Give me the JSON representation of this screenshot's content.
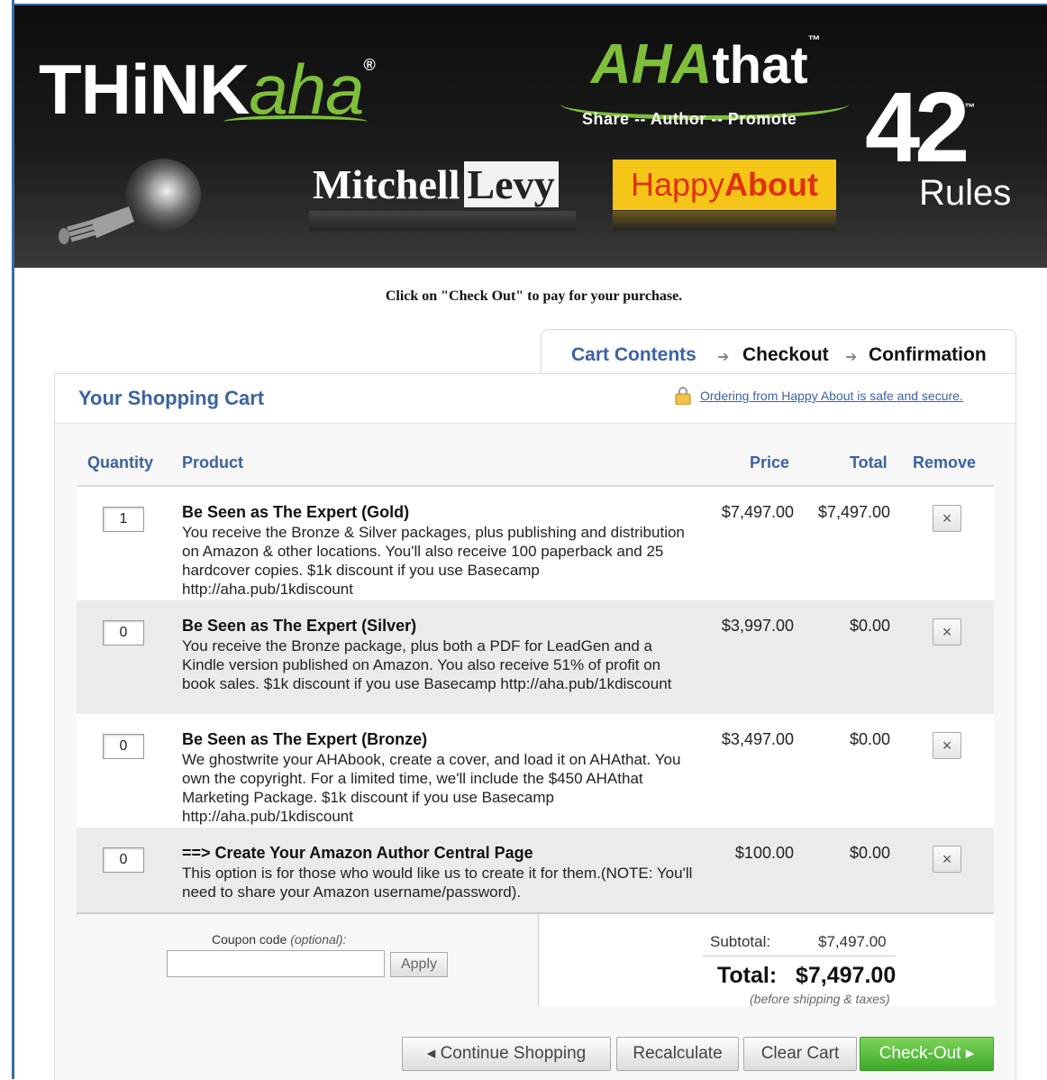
{
  "banner": {
    "brand_think": "THiNK",
    "brand_aha": "aha",
    "brand_reg": "®",
    "ahathat_aha": "AHA",
    "ahathat_that": "that",
    "ahathat_tm": "™",
    "tagline": "Share -- Author -- Promote",
    "mitchell_first": "Mitchell",
    "mitchell_last": "Levy",
    "happy_light": "Happy",
    "happy_bold": "About",
    "rules_number": "42",
    "rules_tm": "™",
    "rules_word": "Rules"
  },
  "instruction": "Click on \"Check Out\" to pay for your purchase.",
  "steps": {
    "step1": "Cart Contents",
    "step2": "Checkout",
    "step3": "Confirmation"
  },
  "cart": {
    "title": "Your Shopping Cart",
    "secure_link": "Ordering from Happy About is safe and secure.",
    "columns": {
      "quantity": "Quantity",
      "product": "Product",
      "price": "Price",
      "total": "Total",
      "remove": "Remove"
    },
    "items": [
      {
        "qty": "1",
        "name": "Be Seen as The Expert (Gold)",
        "desc": "You receive the Bronze & Silver packages, plus publishing and distribution on Amazon & other locations. You'll also receive 100 paperback and 25 hardcover copies. $1k discount if you use Basecamp http://aha.pub/1kdiscount",
        "price": "$7,497.00",
        "total": "$7,497.00",
        "remove": "×"
      },
      {
        "qty": "0",
        "name": "Be Seen as The Expert (Silver)",
        "desc": "You receive the Bronze package, plus both a PDF for LeadGen and a Kindle version published on Amazon. You also receive 51% of profit on book sales. $1k discount if you use Basecamp http://aha.pub/1kdiscount",
        "price": "$3,997.00",
        "total": "$0.00",
        "remove": "×"
      },
      {
        "qty": "0",
        "name": "Be Seen as The Expert (Bronze)",
        "desc": "We ghostwrite your AHAbook, create a cover, and load it on AHAthat. You own the copyright. For a limited time, we'll include the $450 AHAthat Marketing Package. $1k discount if you use Basecamp http://aha.pub/1kdiscount",
        "price": "$3,497.00",
        "total": "$0.00",
        "remove": "×"
      },
      {
        "qty": "0",
        "name": "==> Create Your Amazon Author Central Page",
        "desc": "This option is for those who would like us to create it for them.(NOTE: You'll need to share your Amazon username/password).",
        "price": "$100.00",
        "total": "$0.00",
        "remove": "×"
      }
    ],
    "coupon_label": "Coupon code",
    "coupon_optional": "(optional):",
    "coupon_value": "",
    "apply_label": "Apply",
    "subtotal_label": "Subtotal:",
    "subtotal_value": "$7,497.00",
    "total_label": "Total:",
    "total_value": "$7,497.00",
    "shipping_note": "(before shipping & taxes)"
  },
  "buttons": {
    "continue": "◂ Continue Shopping",
    "recalculate": "Recalculate",
    "clear": "Clear Cart",
    "checkout": "Check-Out ▸"
  },
  "colors": {
    "link_blue": "#3b62a3",
    "checkout_green": "#4cb533",
    "brand_green": "#7fbf3a",
    "happy_yellow": "#f5c518"
  }
}
